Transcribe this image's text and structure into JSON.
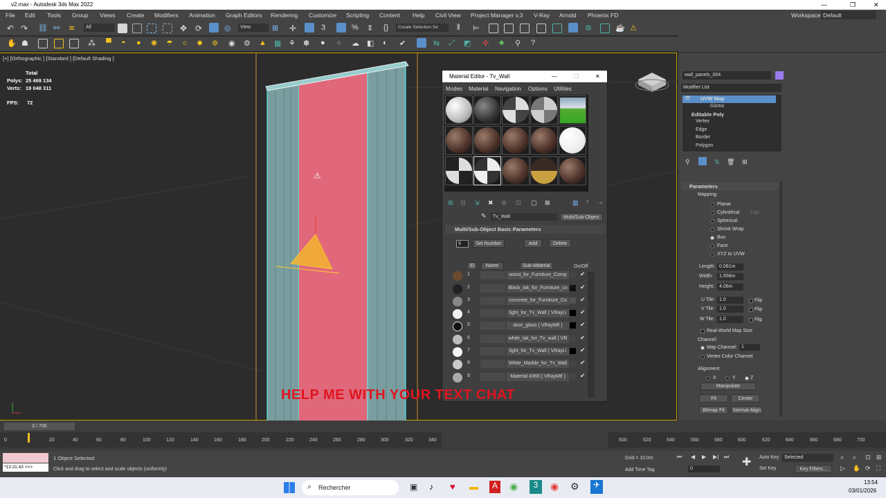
{
  "window": {
    "title": "v2.max - Autodesk 3ds Max 2022",
    "workspaces_label": "Workspaces:",
    "workspace_value": "Default"
  },
  "menu": [
    "File",
    "Edit",
    "Tools",
    "Group",
    "Views",
    "Create",
    "Modifiers",
    "Animation",
    "Graph Editors",
    "Rendering",
    "Customize",
    "Scripting",
    "Content",
    "Help",
    "Civil View",
    "Project Manager v.3",
    "V-Ray",
    "Arnold",
    "Phoenix FD"
  ],
  "toolbar": {
    "filter_value": "All",
    "ref_coord": "View",
    "selection_set_placeholder": "Create Selection Se"
  },
  "viewport": {
    "label": "[+] [Orthographic ] [Standard ] [Default Shading ]",
    "stats_title": "Total",
    "polys_label": "Polys:",
    "polys_value": "25 469 134",
    "verts_label": "Verts:",
    "verts_value": "19 048 311",
    "fps_label": "FPS:",
    "fps_value": "72"
  },
  "overlay_text": "HELP ME WITH YOUR TEXT CHAT",
  "material_editor": {
    "title": "Material Editor - Tv_Wall",
    "menus": [
      "Modes",
      "Material",
      "Navigation",
      "Options",
      "Utilities"
    ],
    "material_name": "Tv_Wall",
    "material_type": "Multi/Sub-Object",
    "rollout": "Multi/Sub-Object Basic Parameters",
    "count_value": "9",
    "set_number": "Set Number",
    "add": "Add",
    "delete": "Delete",
    "col_id": "ID",
    "col_name": "Name",
    "col_sub": "Sub-Material",
    "col_onoff": "On/Off",
    "rows": [
      {
        "id": "1",
        "sub": "wood_for_Furniture_Comp",
        "ball": "#6b4a2d"
      },
      {
        "id": "2",
        "sub": "Black_lak_for_Furniture_co",
        "ball": "#222"
      },
      {
        "id": "3",
        "sub": "concrete_for_Furniture_Co",
        "ball": "#888"
      },
      {
        "id": "4",
        "sub": "light_for_Tv_Wall ( VRayLi",
        "ball": "#f2f2f2"
      },
      {
        "id": "5",
        "sub": "door_glass ( VRayMtl )",
        "ball": "#111"
      },
      {
        "id": "6",
        "sub": "white_lak_for_Tv_wall ( VR",
        "ball": "#bbb"
      },
      {
        "id": "7",
        "sub": "light_for_Tv_Wall ( VRayLi",
        "ball": "#f5f5f5"
      },
      {
        "id": "8",
        "sub": "White_Marble_for_Tv_Wall",
        "ball": "#c9c9c9"
      },
      {
        "id": "9",
        "sub": "Material #369 ( VRayMtl )",
        "ball": "#aaa"
      }
    ]
  },
  "command_panel": {
    "object_name": "wall_panels_004",
    "modifier_list": "Modifier List",
    "stack": [
      "UVW Map",
      "Gizmo",
      "Editable Poly",
      "Vertex",
      "Edge",
      "Border",
      "Polygon"
    ],
    "rollout": "Parameters",
    "mapping_label": "Mapping:",
    "mapping_options": [
      "Planar",
      "Cylindrical",
      "Spherical",
      "Shrink Wrap",
      "Box",
      "Face",
      "XYZ to UVW"
    ],
    "cap": "Cap",
    "length_label": "Length:",
    "length_value": "0.061m",
    "width_label": "Width:",
    "width_value": "1.658m",
    "height_label": "Height:",
    "height_value": "4.06m",
    "utile_label": "U Tile:",
    "utile_value": "1.0",
    "vtile_label": "V Tile:",
    "vtile_value": "1.0",
    "wtile_label": "W Tile:",
    "wtile_value": "1.0",
    "flip": "Flip",
    "real_world": "Real-World Map Size",
    "channel_label": "Channel:",
    "map_channel": "Map Channel:",
    "map_channel_value": "1",
    "vertex_color": "Vertex Color Channel",
    "alignment_label": "Alignment:",
    "axes": [
      "X",
      "Y",
      "Z"
    ],
    "manipulate": "Manipulate",
    "fit": "Fit",
    "center": "Center",
    "bitmap_fit": "Bitmap Fit",
    "normal_align": "Normal Align"
  },
  "timeline": {
    "frame": "0 / 700",
    "ticks_left": [
      "0",
      "20",
      "40",
      "60",
      "80",
      "100",
      "120",
      "140",
      "160",
      "180",
      "200",
      "220",
      "240",
      "260",
      "280",
      "300",
      "320",
      "340"
    ],
    "ticks_right": [
      "500",
      "520",
      "540",
      "560",
      "580",
      "600",
      "620",
      "640",
      "660",
      "680",
      "700"
    ]
  },
  "status": {
    "selected": "1 Object Selected",
    "hint": "Click and drag to select and scale objects (uniformly)",
    "time_display": "*13:21:43 >>>",
    "grid": "Grid = 10.0m",
    "add_time_tag": "Add Time Tag",
    "auto_key": "Auto Key",
    "set_key": "Set Key",
    "selected_dropdown": "Selected",
    "key_filters": "Key Filters...",
    "frame_value": "0"
  },
  "taskbar": {
    "search": "Rechercher",
    "time": "13:54",
    "date": "03/01/2026"
  }
}
